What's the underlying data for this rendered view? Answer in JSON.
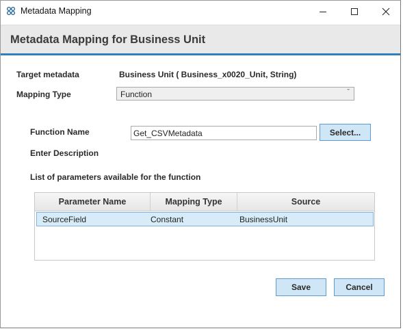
{
  "window": {
    "title": "Metadata Mapping",
    "app_icon": "link-grid-icon",
    "controls": {
      "minimize": "minimize-icon",
      "maximize": "maximize-icon",
      "close": "close-icon"
    }
  },
  "header": {
    "title": "Metadata Mapping for Business Unit",
    "accent_color": "#2d7fc0"
  },
  "form": {
    "target_metadata_label": "Target metadata",
    "target_metadata_value": "Business Unit ( Business_x0020_Unit, String)",
    "mapping_type_label": "Mapping Type",
    "mapping_type_value": "Function",
    "function_name_label": "Function Name",
    "function_name_value": "Get_CSVMetadata",
    "select_button": "Select...",
    "description_label": "Enter Description",
    "params_label": "List of parameters available for the function"
  },
  "grid": {
    "columns": [
      "Parameter Name",
      "Mapping Type",
      "Source"
    ],
    "rows": [
      [
        "SourceField",
        "Constant",
        "BusinessUnit"
      ]
    ]
  },
  "footer": {
    "save_label": "Save",
    "cancel_label": "Cancel",
    "button_color": "#cfe6f6"
  }
}
